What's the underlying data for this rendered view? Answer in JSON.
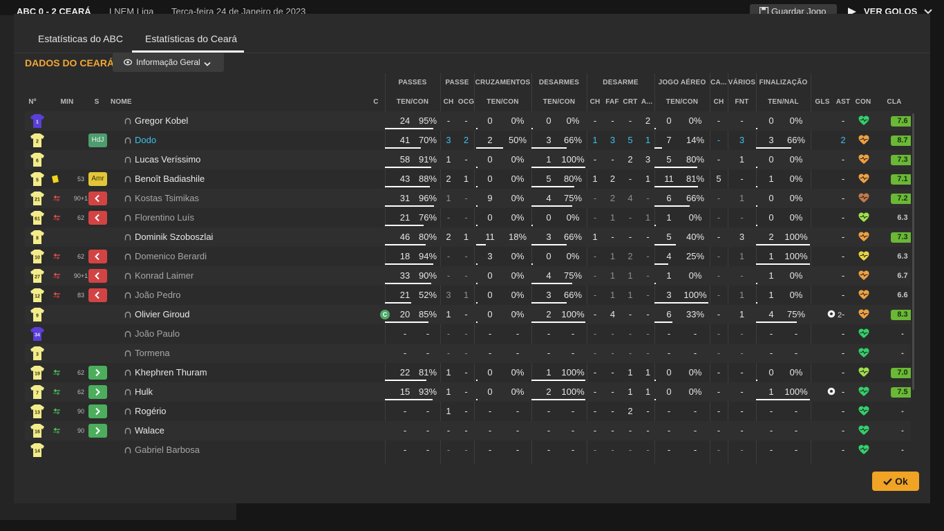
{
  "topbar": {
    "score": "ABC 0 - 2 CEARÁ",
    "league": "LNEM Liga",
    "date": "Terça-feira 24 de Janeiro de 2023",
    "save_label": "Guardar Jogo",
    "goals_label": "VER GOLOS"
  },
  "tabs": [
    "Estatísticas do ABC",
    "Estatísticas do Ceará"
  ],
  "active_tab": 1,
  "heading": "DADOS DO CEARÁ",
  "view_select": {
    "label": "Informação Geral"
  },
  "column_groups": [
    "PASSES",
    "PASSE",
    "CRUZAMENTOS",
    "DESARMES",
    "DESARME",
    "JOGO AÉREO",
    "CA...",
    "VÁRIOS",
    "FINALIZAÇÃO"
  ],
  "columns": [
    "Nº",
    "MIN",
    "S",
    "NOME",
    "C",
    "TEN/CON",
    "CH",
    "OCG",
    "TEN/CON",
    "TEN/CON",
    "CH",
    "FAF",
    "CRT",
    "A...",
    "TEN/CON",
    "CH",
    "FNT",
    "TEN/NAL",
    "GLS",
    "AST",
    "CON",
    "CLA"
  ],
  "colors": {
    "accent": "#f2a832",
    "shirt": "#f2ec8c",
    "keeper": "#5b3fd6",
    "highlight_blue": "#3ec2ea",
    "rating_green": "#6ab836",
    "sub_out": "#d24444",
    "sub_in": "#4cae5c"
  },
  "players": [
    {
      "num": "1",
      "keeper": true,
      "min": "",
      "yellow": false,
      "sub": "",
      "badge": "",
      "name": "Gregor Kobel",
      "style": "",
      "captain": false,
      "pass": [
        "24",
        "95%"
      ],
      "passe": [
        "-",
        "-"
      ],
      "cross": [
        "0",
        "0%"
      ],
      "tackles": [
        "0",
        "0%"
      ],
      "des": [
        "-",
        "-",
        "-",
        "2"
      ],
      "aerial": [
        "0",
        "0%"
      ],
      "ca": "-",
      "fnt": "-",
      "fin": [
        "0",
        "0%"
      ],
      "gls": "",
      "ast": "-",
      "con": "green",
      "cla": "7.6",
      "cla_hi": true,
      "pass_frac": 0.95,
      "cross_frac": 0,
      "tackle_frac": 0,
      "aerial_frac": 0,
      "fin_frac": 0
    },
    {
      "num": "2",
      "keeper": false,
      "min": "",
      "yellow": false,
      "sub": "",
      "badge": "HdJ",
      "name": "Dodo",
      "style": "blue",
      "captain": false,
      "pass": [
        "41",
        "70%"
      ],
      "passe": [
        "3",
        "2"
      ],
      "cross": [
        "2",
        "50%"
      ],
      "tackles": [
        "3",
        "66%"
      ],
      "des": [
        "1",
        "3",
        "5",
        "1"
      ],
      "aerial": [
        "7",
        "14%"
      ],
      "ca": "-",
      "fnt": "3",
      "fin": [
        "3",
        "66%"
      ],
      "gls": "",
      "ast": "2",
      "con": "orange",
      "cla": "8.7",
      "cla_hi": true,
      "pass_frac": 0.7,
      "cross_frac": 0.5,
      "tackle_frac": 0.66,
      "aerial_frac": 0.14,
      "fin_frac": 0.66,
      "blue_cols": true
    },
    {
      "num": "6",
      "keeper": false,
      "min": "",
      "yellow": false,
      "sub": "",
      "badge": "",
      "name": "Lucas Veríssimo",
      "style": "",
      "captain": false,
      "pass": [
        "58",
        "91%"
      ],
      "passe": [
        "1",
        "-"
      ],
      "cross": [
        "0",
        "0%"
      ],
      "tackles": [
        "1",
        "100%"
      ],
      "des": [
        "-",
        "-",
        "2",
        "3"
      ],
      "aerial": [
        "5",
        "80%"
      ],
      "ca": "-",
      "fnt": "1",
      "fin": [
        "0",
        "0%"
      ],
      "gls": "",
      "ast": "-",
      "con": "orange",
      "cla": "7.3",
      "cla_hi": true,
      "pass_frac": 0.91,
      "cross_frac": 0,
      "tackle_frac": 1,
      "aerial_frac": 0.8,
      "fin_frac": 0
    },
    {
      "num": "5",
      "keeper": false,
      "min": "53",
      "yellow": true,
      "sub": "",
      "badge": "Amr",
      "name": "Benoît Badiashile",
      "style": "",
      "captain": false,
      "pass": [
        "43",
        "88%"
      ],
      "passe": [
        "2",
        "1"
      ],
      "cross": [
        "0",
        "0%"
      ],
      "tackles": [
        "5",
        "80%"
      ],
      "des": [
        "1",
        "2",
        "-",
        "1"
      ],
      "aerial": [
        "11",
        "81%"
      ],
      "ca": "5",
      "fnt": "-",
      "fin": [
        "1",
        "0%"
      ],
      "gls": "",
      "ast": "-",
      "con": "orange",
      "cla": "7.1",
      "cla_hi": true,
      "pass_frac": 0.88,
      "cross_frac": 0,
      "tackle_frac": 0.8,
      "aerial_frac": 0.81,
      "fin_frac": 0
    },
    {
      "num": "21",
      "keeper": false,
      "min": "90+1",
      "yellow": false,
      "sub": "out",
      "badge": "",
      "name": "Kostas Tsimikas",
      "style": "dim",
      "captain": false,
      "pass": [
        "31",
        "96%"
      ],
      "passe": [
        "1",
        "-"
      ],
      "cross": [
        "9",
        "0%"
      ],
      "tackles": [
        "4",
        "75%"
      ],
      "des": [
        "-",
        "2",
        "4",
        "-"
      ],
      "aerial": [
        "6",
        "66%"
      ],
      "ca": "-",
      "fnt": "1",
      "fin": [
        "0",
        "0%"
      ],
      "gls": "",
      "ast": "-",
      "con": "brown",
      "cla": "7.2",
      "cla_hi": true,
      "pass_frac": 0.96,
      "cross_frac": 0,
      "tackle_frac": 0.75,
      "aerial_frac": 0.66,
      "fin_frac": 0
    },
    {
      "num": "61",
      "keeper": false,
      "min": "62",
      "yellow": false,
      "sub": "out",
      "badge": "",
      "name": "Florentino Luís",
      "style": "dim",
      "captain": false,
      "pass": [
        "21",
        "76%"
      ],
      "passe": [
        "-",
        "-"
      ],
      "cross": [
        "0",
        "0%"
      ],
      "tackles": [
        "0",
        "0%"
      ],
      "des": [
        "-",
        "1",
        "-",
        "1"
      ],
      "aerial": [
        "1",
        "0%"
      ],
      "ca": "-",
      "fnt": "-",
      "fin": [
        "0",
        "0%"
      ],
      "gls": "",
      "ast": "-",
      "con": "lime",
      "cla": "6.3",
      "cla_hi": false,
      "pass_frac": 0.76,
      "cross_frac": 0,
      "tackle_frac": 0,
      "aerial_frac": 0,
      "fin_frac": 0
    },
    {
      "num": "8",
      "keeper": false,
      "min": "",
      "yellow": false,
      "sub": "",
      "badge": "",
      "name": "Dominik Szoboszlai",
      "style": "",
      "captain": false,
      "pass": [
        "46",
        "80%"
      ],
      "passe": [
        "2",
        "1"
      ],
      "cross": [
        "11",
        "18%"
      ],
      "tackles": [
        "3",
        "66%"
      ],
      "des": [
        "1",
        "-",
        "-",
        "-"
      ],
      "aerial": [
        "5",
        "40%"
      ],
      "ca": "-",
      "fnt": "3",
      "fin": [
        "2",
        "100%"
      ],
      "gls": "",
      "ast": "-",
      "con": "orange",
      "cla": "7.3",
      "cla_hi": true,
      "pass_frac": 0.8,
      "cross_frac": 0.18,
      "tackle_frac": 0.66,
      "aerial_frac": 0.4,
      "fin_frac": 1
    },
    {
      "num": "10",
      "keeper": false,
      "min": "62",
      "yellow": false,
      "sub": "out",
      "badge": "",
      "name": "Domenico Berardi",
      "style": "dim",
      "captain": false,
      "pass": [
        "18",
        "94%"
      ],
      "passe": [
        "-",
        "-"
      ],
      "cross": [
        "3",
        "0%"
      ],
      "tackles": [
        "0",
        "0%"
      ],
      "des": [
        "-",
        "1",
        "2",
        "-"
      ],
      "aerial": [
        "4",
        "25%"
      ],
      "ca": "-",
      "fnt": "1",
      "fin": [
        "1",
        "100%"
      ],
      "gls": "",
      "ast": "-",
      "con": "yellow",
      "cla": "6.3",
      "cla_hi": false,
      "pass_frac": 0.94,
      "cross_frac": 0,
      "tackle_frac": 0,
      "aerial_frac": 0.25,
      "fin_frac": 1
    },
    {
      "num": "27",
      "keeper": false,
      "min": "90+1",
      "yellow": false,
      "sub": "out",
      "badge": "",
      "name": "Konrad Laimer",
      "style": "dim",
      "captain": false,
      "pass": [
        "33",
        "90%"
      ],
      "passe": [
        "-",
        "-"
      ],
      "cross": [
        "0",
        "0%"
      ],
      "tackles": [
        "4",
        "75%"
      ],
      "des": [
        "-",
        "1",
        "1",
        "-"
      ],
      "aerial": [
        "1",
        "0%"
      ],
      "ca": "-",
      "fnt": "-",
      "fin": [
        "1",
        "0%"
      ],
      "gls": "",
      "ast": "-",
      "con": "orange",
      "cla": "6.7",
      "cla_hi": false,
      "pass_frac": 0.9,
      "cross_frac": 0,
      "tackle_frac": 0.75,
      "aerial_frac": 0,
      "fin_frac": 0
    },
    {
      "num": "12",
      "keeper": false,
      "min": "83",
      "yellow": false,
      "sub": "out",
      "badge": "",
      "name": "João Pedro",
      "style": "dim",
      "captain": false,
      "pass": [
        "21",
        "52%"
      ],
      "passe": [
        "3",
        "1"
      ],
      "cross": [
        "0",
        "0%"
      ],
      "tackles": [
        "3",
        "66%"
      ],
      "des": [
        "-",
        "1",
        "1",
        "-"
      ],
      "aerial": [
        "3",
        "100%"
      ],
      "ca": "-",
      "fnt": "1",
      "fin": [
        "1",
        "0%"
      ],
      "gls": "",
      "ast": "-",
      "con": "orange",
      "cla": "6.6",
      "cla_hi": false,
      "pass_frac": 0.52,
      "cross_frac": 0,
      "tackle_frac": 0.66,
      "aerial_frac": 1,
      "fin_frac": 0
    },
    {
      "num": "9",
      "keeper": false,
      "min": "",
      "yellow": false,
      "sub": "",
      "badge": "",
      "name": "Olivier Giroud",
      "style": "",
      "captain": true,
      "pass": [
        "20",
        "85%"
      ],
      "passe": [
        "1",
        "-"
      ],
      "cross": [
        "0",
        "0%"
      ],
      "tackles": [
        "2",
        "100%"
      ],
      "des": [
        "-",
        "4",
        "-",
        "-"
      ],
      "aerial": [
        "6",
        "33%"
      ],
      "ca": "-",
      "fnt": "1",
      "fin": [
        "4",
        "75%"
      ],
      "gls": "2",
      "ast": "-",
      "con": "orange",
      "cla": "8.3",
      "cla_hi": true,
      "pass_frac": 0.85,
      "cross_frac": 0,
      "tackle_frac": 1,
      "aerial_frac": 0.33,
      "fin_frac": 0.75
    },
    {
      "num": "34",
      "keeper": true,
      "min": "",
      "yellow": false,
      "sub": "",
      "badge": "",
      "name": "João Paulo",
      "style": "dim",
      "captain": false,
      "pass": [
        "-",
        "-"
      ],
      "passe": [
        "-",
        "-"
      ],
      "cross": [
        "-",
        "-"
      ],
      "tackles": [
        "-",
        "-"
      ],
      "des": [
        "-",
        "-",
        "-",
        "-"
      ],
      "aerial": [
        "-",
        "-"
      ],
      "ca": "-",
      "fnt": "-",
      "fin": [
        "-",
        "-"
      ],
      "gls": "",
      "ast": "-",
      "con": "green",
      "cla": "-",
      "cla_hi": false
    },
    {
      "num": "3",
      "keeper": false,
      "min": "",
      "yellow": false,
      "sub": "",
      "badge": "",
      "name": "Tormena",
      "style": "dim",
      "captain": false,
      "pass": [
        "-",
        "-"
      ],
      "passe": [
        "-",
        "-"
      ],
      "cross": [
        "-",
        "-"
      ],
      "tackles": [
        "-",
        "-"
      ],
      "des": [
        "-",
        "-",
        "-",
        "-"
      ],
      "aerial": [
        "-",
        "-"
      ],
      "ca": "-",
      "fnt": "-",
      "fin": [
        "-",
        "-"
      ],
      "gls": "",
      "ast": "-",
      "con": "green",
      "cla": "-",
      "cla_hi": false
    },
    {
      "num": "19",
      "keeper": false,
      "min": "62",
      "yellow": false,
      "sub": "in",
      "badge": "",
      "name": "Khephren Thuram",
      "style": "",
      "captain": false,
      "pass": [
        "22",
        "81%"
      ],
      "passe": [
        "1",
        "-"
      ],
      "cross": [
        "0",
        "0%"
      ],
      "tackles": [
        "1",
        "100%"
      ],
      "des": [
        "-",
        "-",
        "1",
        "1"
      ],
      "aerial": [
        "0",
        "0%"
      ],
      "ca": "-",
      "fnt": "-",
      "fin": [
        "0",
        "0%"
      ],
      "gls": "",
      "ast": "-",
      "con": "lime",
      "cla": "7.0",
      "cla_hi": true,
      "pass_frac": 0.81,
      "cross_frac": 0,
      "tackle_frac": 1,
      "aerial_frac": 0,
      "fin_frac": 0
    },
    {
      "num": "7",
      "keeper": false,
      "min": "62",
      "yellow": false,
      "sub": "in",
      "badge": "",
      "name": "Hulk",
      "style": "",
      "captain": false,
      "pass": [
        "15",
        "93%"
      ],
      "passe": [
        "1",
        "-"
      ],
      "cross": [
        "0",
        "0%"
      ],
      "tackles": [
        "2",
        "100%"
      ],
      "des": [
        "-",
        "-",
        "1",
        "1"
      ],
      "aerial": [
        "0",
        "0%"
      ],
      "ca": "-",
      "fnt": "-",
      "fin": [
        "1",
        "100%"
      ],
      "gls": "1",
      "ast": "-",
      "con": "green",
      "cla": "7.5",
      "cla_hi": true,
      "pass_frac": 0.93,
      "cross_frac": 0,
      "tackle_frac": 1,
      "aerial_frac": 0,
      "fin_frac": 1
    },
    {
      "num": "13",
      "keeper": false,
      "min": "90",
      "yellow": false,
      "sub": "in",
      "badge": "",
      "name": "Rogério",
      "style": "",
      "captain": false,
      "pass": [
        "-",
        "-"
      ],
      "passe": [
        "1",
        "-"
      ],
      "cross": [
        "-",
        "-"
      ],
      "tackles": [
        "-",
        "-"
      ],
      "des": [
        "-",
        "-",
        "2",
        "-"
      ],
      "aerial": [
        "-",
        "-"
      ],
      "ca": "-",
      "fnt": "-",
      "fin": [
        "-",
        "-"
      ],
      "gls": "",
      "ast": "-",
      "con": "green",
      "cla": "-",
      "cla_hi": false
    },
    {
      "num": "16",
      "keeper": false,
      "min": "90",
      "yellow": false,
      "sub": "in",
      "badge": "",
      "name": "Walace",
      "style": "",
      "captain": false,
      "pass": [
        "-",
        "-"
      ],
      "passe": [
        "-",
        "-"
      ],
      "cross": [
        "-",
        "-"
      ],
      "tackles": [
        "-",
        "-"
      ],
      "des": [
        "-",
        "-",
        "-",
        "-"
      ],
      "aerial": [
        "-",
        "-"
      ],
      "ca": "-",
      "fnt": "-",
      "fin": [
        "-",
        "-"
      ],
      "gls": "",
      "ast": "-",
      "con": "green",
      "cla": "-",
      "cla_hi": false
    },
    {
      "num": "14",
      "keeper": false,
      "min": "",
      "yellow": false,
      "sub": "",
      "badge": "",
      "name": "Gabriel Barbosa",
      "style": "dim",
      "captain": false,
      "pass": [
        "-",
        "-"
      ],
      "passe": [
        "-",
        "-"
      ],
      "cross": [
        "-",
        "-"
      ],
      "tackles": [
        "-",
        "-"
      ],
      "des": [
        "-",
        "-",
        "-",
        "-"
      ],
      "aerial": [
        "-",
        "-"
      ],
      "ca": "-",
      "fnt": "-",
      "fin": [
        "-",
        "-"
      ],
      "gls": "",
      "ast": "-",
      "con": "green",
      "cla": "-",
      "cla_hi": false
    }
  ],
  "ok_label": "Ok"
}
